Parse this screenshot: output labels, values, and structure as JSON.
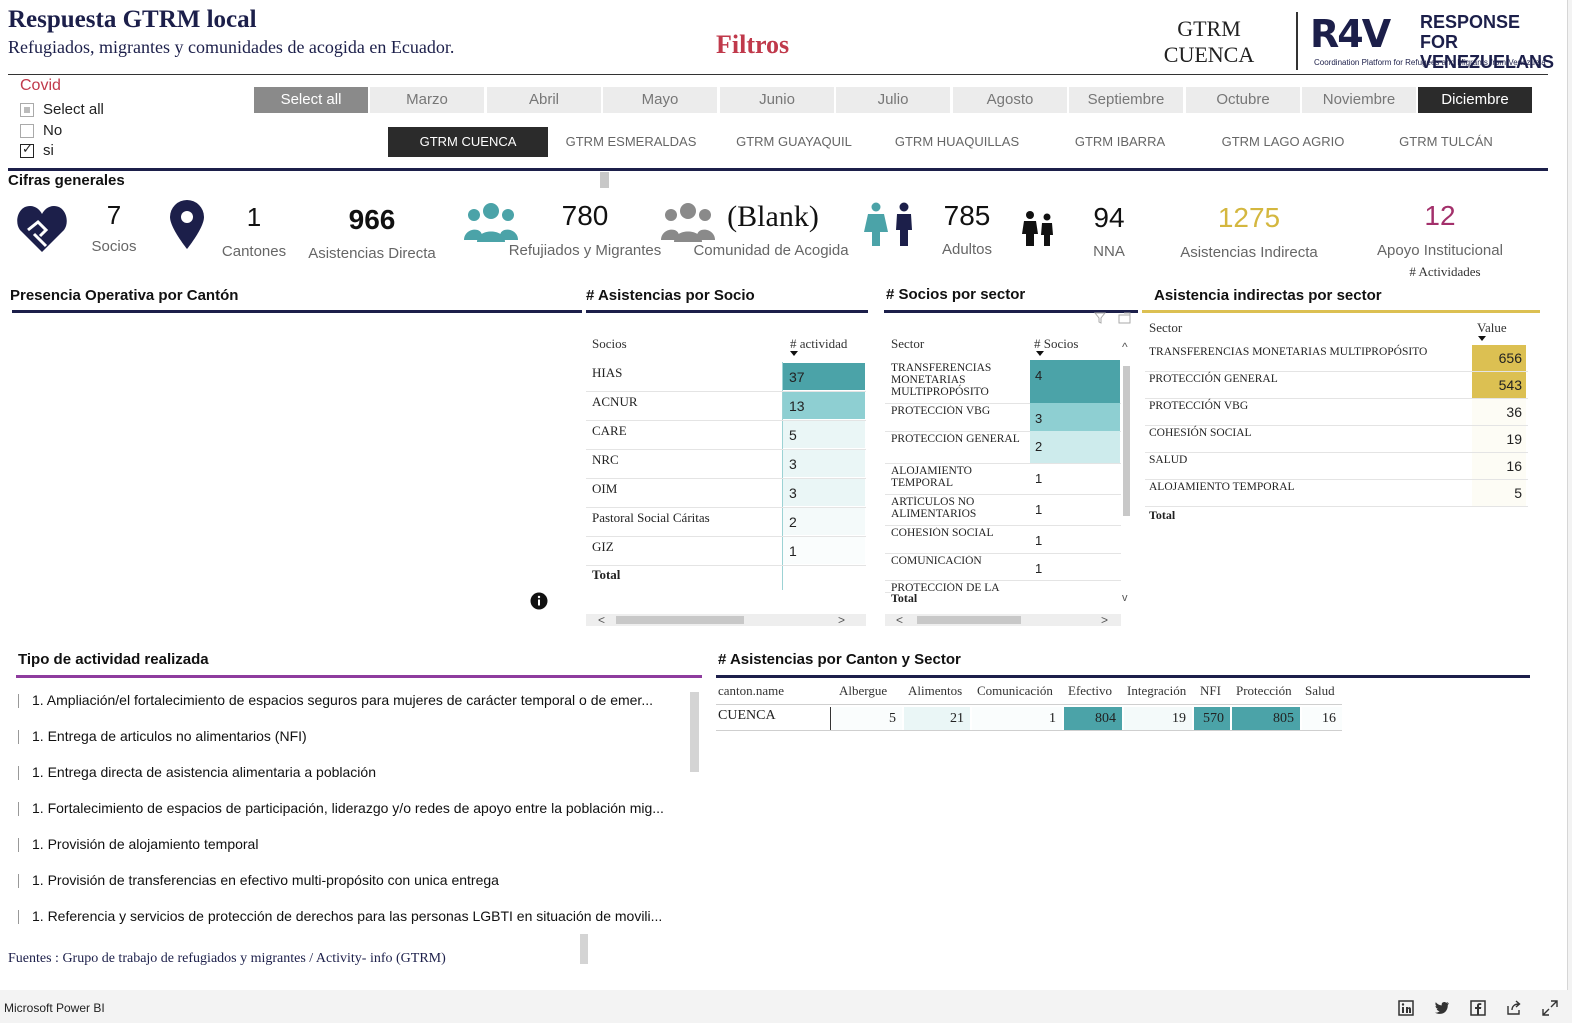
{
  "header": {
    "title": "Respuesta GTRM local",
    "subtitle": "Refugiados, migrantes y comunidades de acogida en Ecuador.",
    "filters_label": "Filtros",
    "gtrm_line1": "GTRM",
    "gtrm_line2": "CUENCA",
    "logo_main_line1": "RESPONSE FOR",
    "logo_main_line2": "VENEZUELANS",
    "logo_tagline": "Coordination Platform for Refugees and Migrants from Venezuela",
    "logo_mark": "R4V"
  },
  "covid": {
    "title": "Covid",
    "options": [
      {
        "label": "Select all",
        "state": "partial"
      },
      {
        "label": "No",
        "state": "unchecked"
      },
      {
        "label": "si",
        "state": "checked"
      }
    ]
  },
  "months": [
    "Select all",
    "Marzo",
    "Abril",
    "Mayo",
    "Junio",
    "Julio",
    "Agosto",
    "Septiembre",
    "Octubre",
    "Noviembre",
    "Diciembre"
  ],
  "gtrm_tabs": [
    "GTRM CUENCA",
    "GTRM ESMERALDAS",
    "GTRM GUAYAQUIL",
    "GTRM HUAQUILLAS",
    "GTRM IBARRA",
    "GTRM LAGO AGRIO",
    "GTRM TULCÁN"
  ],
  "cifras": {
    "title": "Cifras generales",
    "socios_value": "7",
    "socios_label": "Socios",
    "cantones_value": "1",
    "cantones_label": "Cantones",
    "asist_directa_value": "966",
    "asist_directa_label": "Asistencias Directa",
    "refugiados_value": "780",
    "refugiados_label": "Refujiados y Migrantes",
    "comunidad_value": "(Blank)",
    "comunidad_label": "Comunidad de Acogida",
    "adultos_value": "785",
    "adultos_label": "Adultos",
    "nna_value": "94",
    "nna_label": "NNA",
    "asist_indirecta_value": "1275",
    "asist_indirecta_label": "Asistencias Indirecta",
    "apoyo_value": "12",
    "apoyo_label": "Apoyo Institucional",
    "apoyo_sublabel": "# Actividades"
  },
  "presencia": {
    "title": "Presencia Operativa por Cantón"
  },
  "socio_table": {
    "title": "# Asistencias por Socio",
    "col1": "Socios",
    "col2": "# actividad",
    "rows": [
      {
        "name": "HIAS",
        "value": "37"
      },
      {
        "name": "ACNUR",
        "value": "13"
      },
      {
        "name": "CARE",
        "value": "5"
      },
      {
        "name": "NRC",
        "value": "3"
      },
      {
        "name": "OIM",
        "value": "3"
      },
      {
        "name": "Pastoral Social Cáritas",
        "value": "2"
      },
      {
        "name": "GIZ",
        "value": "1"
      }
    ],
    "total": "Total"
  },
  "sector_table": {
    "title": "# Socios por sector",
    "col1": "Sector",
    "col2": "# Socios",
    "rows": [
      {
        "name": "TRANSFERENCIAS MONETARIAS MULTIPROPÓSITO",
        "value": "4"
      },
      {
        "name": "PROTECCIÓN VBG",
        "value": "3"
      },
      {
        "name": "PROTECCIÓN GENERAL",
        "value": "2"
      },
      {
        "name": "ALOJAMIENTO TEMPORAL",
        "value": "1"
      },
      {
        "name": "ARTÍCULOS NO ALIMENTARIOS",
        "value": "1"
      },
      {
        "name": "COHESIÓN SOCIAL",
        "value": "1"
      },
      {
        "name": "COMUNICACIÓN",
        "value": "1"
      },
      {
        "name": "PROTECCIÓN DE LA",
        "value": ""
      }
    ],
    "total": "Total"
  },
  "indirect_table": {
    "title": "Asistencia indirectas por sector",
    "col1": "Sector",
    "col2": "Value",
    "rows": [
      {
        "name": "TRANSFERENCIAS MONETARIAS MULTIPROPÓSITO",
        "value": "656"
      },
      {
        "name": "PROTECCIÓN GENERAL",
        "value": "543"
      },
      {
        "name": "PROTECCIÓN VBG",
        "value": "36"
      },
      {
        "name": "COHESIÓN SOCIAL",
        "value": "19"
      },
      {
        "name": "SALUD",
        "value": "16"
      },
      {
        "name": "ALOJAMIENTO TEMPORAL",
        "value": "5"
      }
    ],
    "total": "Total"
  },
  "activities": {
    "title": "Tipo de actividad realizada",
    "items": [
      "1. Ampliación/el fortalecimiento de espacios seguros para mujeres de carácter temporal o de emer...",
      "1. Entrega de articulos no alimentarios (NFI)",
      "1. Entrega directa de asistencia alimentaria a población",
      "1. Fortalecimiento de espacios de participación, liderazgo y/o redes de apoyo entre la población mig...",
      "1. Provisión de alojamiento temporal",
      "1. Provisión de transferencias en efectivo multi-propósito con unica entrega",
      "1. Referencia y servicios de protección de derechos para las personas LGBTI en situación de movili..."
    ]
  },
  "canton_table": {
    "title": "# Asistencias por Canton y Sector",
    "headers": [
      "canton.name",
      "Albergue",
      "Alimentos",
      "Comunicación",
      "Efectivo",
      "Integración",
      "NFI",
      "Protección",
      "Salud"
    ],
    "row_label": "CUENCA",
    "values": [
      "5",
      "21",
      "1",
      "804",
      "19",
      "570",
      "805",
      "16"
    ]
  },
  "footer": {
    "sources": "Fuentes : Grupo de trabajo de refugiados y migrantes / Activity- info (GTRM)",
    "app": "Microsoft Power BI"
  },
  "colors": {
    "navy": "#1c1f4a",
    "teal_dark": "#4ba3a8",
    "teal_mid": "#8ecfd2",
    "teal_light": "#cdebec",
    "teal_faint": "#eaf6f6",
    "gold": "#dcc052",
    "gold_text": "#d4b73f",
    "magenta": "#a3306b",
    "purple": "#8e3c9e"
  }
}
